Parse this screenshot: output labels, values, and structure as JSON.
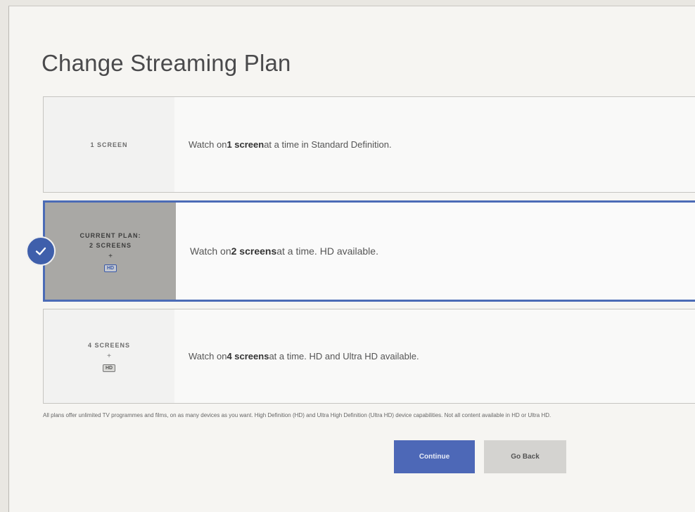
{
  "title": "Change Streaming Plan",
  "plans": [
    {
      "label": "1 SCREEN",
      "desc_pre": "Watch on ",
      "desc_bold": "1 screen",
      "desc_post": " at a time in Standard Definition."
    },
    {
      "current_label": "CURRENT PLAN:",
      "label": "2 SCREENS",
      "dot": "+",
      "badge": "HD",
      "desc_pre": "Watch on ",
      "desc_bold": "2 screens",
      "desc_post": " at a time. HD available."
    },
    {
      "label": "4 SCREENS",
      "dot": "+",
      "badge": "HD",
      "desc_pre": "Watch on ",
      "desc_bold": "4 screens",
      "desc_post": " at a time. HD and Ultra HD available."
    }
  ],
  "footnote": "All plans offer unlimited TV programmes and films, on as many devices as you want. High Definition (HD) and Ultra High Definition (Ultra HD) device capabilities. Not all content available in HD or Ultra HD.",
  "buttons": {
    "continue": "Continue",
    "back": "Go Back"
  },
  "colors": {
    "accent": "#4b6bb6",
    "check_bg": "#3f5fab",
    "selected_left_bg": "#a9a8a5"
  },
  "icons": {
    "selected": "checkmark-icon",
    "hd": "hd-badge-icon"
  }
}
